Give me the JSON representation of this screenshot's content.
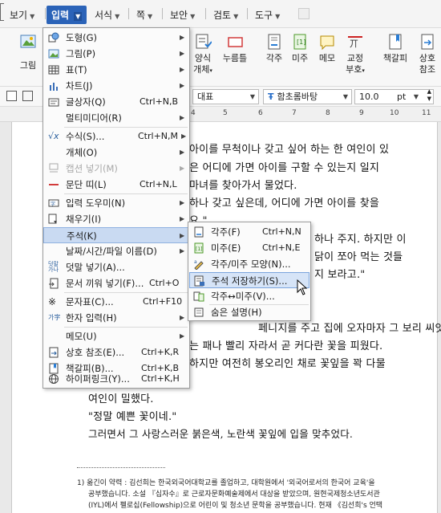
{
  "menubar": {
    "items": [
      {
        "label": "보기"
      },
      {
        "label": "입력"
      },
      {
        "label": "서식"
      },
      {
        "label": "쪽"
      },
      {
        "label": "보안"
      },
      {
        "label": "검토"
      },
      {
        "label": "도구"
      }
    ]
  },
  "toolbar": {
    "picture_label": "그림",
    "form_label_1": "양식",
    "form_label_2": "개체",
    "button_label": "누름틀",
    "footnote_label": "각주",
    "endnote_label": "미주",
    "memo_label": "메모",
    "proof_label_1": "교정",
    "proof_label_2": "부호",
    "bookmark_label": "책갈피",
    "crossref_label_1": "상호",
    "crossref_label_2": "참조"
  },
  "format": {
    "style": "대표",
    "font": "함초롬바탕",
    "font_icon": "Ŧ",
    "size": "10.0",
    "unit": "pt"
  },
  "ruler": {
    "numbers": [
      "4",
      "5",
      "6",
      "7",
      "8",
      "9",
      "10",
      "11"
    ]
  },
  "input_menu": {
    "items": [
      {
        "label": "도형(G)",
        "shortcut": "",
        "sub": true
      },
      {
        "label": "그림(P)",
        "shortcut": "",
        "sub": true
      },
      {
        "label": "표(T)",
        "shortcut": "",
        "sub": true
      },
      {
        "label": "차트(J)",
        "shortcut": "",
        "sub": true
      },
      {
        "label": "글상자(Q)",
        "shortcut": "Ctrl+N,B",
        "sub": false
      },
      {
        "label": "멀티미디어(R)",
        "shortcut": "",
        "sub": true
      },
      {
        "label": "수식(S)...",
        "shortcut": "Ctrl+N,M",
        "sub": true
      },
      {
        "label": "개체(O)",
        "shortcut": "",
        "sub": true
      },
      {
        "label": "캡션 넣기(M)",
        "shortcut": "",
        "sub": true
      },
      {
        "label": "문단 띠(L)",
        "shortcut": "Ctrl+N,L",
        "sub": false
      },
      {
        "label": "입력 도우미(N)",
        "shortcut": "",
        "sub": true
      },
      {
        "label": "채우기(I)",
        "shortcut": "",
        "sub": true
      },
      {
        "label": "주석(K)",
        "shortcut": "",
        "sub": true
      },
      {
        "label": "날짜/시간/파일 이름(D)",
        "shortcut": "",
        "sub": true
      },
      {
        "label": "덧말 넣기(A)...",
        "shortcut": "",
        "sub": false
      },
      {
        "label": "문서 끼워 넣기(F)...",
        "shortcut": "Ctrl+O",
        "sub": false
      },
      {
        "label": "문자표(C)...",
        "shortcut": "Ctrl+F10",
        "sub": false
      },
      {
        "label": "한자 입력(H)",
        "shortcut": "",
        "sub": true
      },
      {
        "label": "메모(U)",
        "shortcut": "",
        "sub": true
      },
      {
        "label": "상호 참조(E)...",
        "shortcut": "Ctrl+K,R",
        "sub": false
      },
      {
        "label": "책갈피(B)...",
        "shortcut": "Ctrl+K,B",
        "sub": false
      },
      {
        "label": "하이퍼링크(Y)...",
        "shortcut": "Ctrl+K,H",
        "sub": false
      }
    ]
  },
  "note_submenu": {
    "items": [
      {
        "label": "각주(F)",
        "shortcut": "Ctrl+N,N"
      },
      {
        "label": "미주(E)",
        "shortcut": "Ctrl+N,E"
      },
      {
        "label": "각주/미주 모양(N)...",
        "shortcut": ""
      },
      {
        "label": "주석 저장하기(S)...",
        "shortcut": ""
      },
      {
        "label": "각주↔미주(V)...",
        "shortcut": ""
      },
      {
        "label": "숨은 설명(H)",
        "shortcut": ""
      }
    ]
  },
  "document": {
    "lines": [
      "아이를 무척이나 갖고 싶어 하는 한 여인이 있",
      "은 어디에 가면 아이를 구할 수 있는지 일지",
      "마녀를 찾아가서 물었다.",
      "하나 갖고 싶은데, 어디에 가면 아이를 찾을",
      "요.\"",
      "하나 주지. 하지만 이",
      "닭이 쪼아 먹는 것들",
      "지 보라고.\"",
      "페니지를 주고 집에 오자마자 그 보리 씨앗을",
      "는 패나 빨리 자라서 곧 커다란 꽃을 피웠다.",
      "하지만 여전히 봉오리인 채로 꽃잎을 꽉 다물",
      "여인이 밀했다.",
      "\"정말 예쁜 꽃이네.\"",
      "그러면서 그 사랑스러운 붉은색, 노란색 꽃잎에 입을 맞추었다."
    ],
    "footnote": [
      "1) 옮긴이 약력 : 김선희는 한국외국어대학교를 졸업하고, 대학원에서 '외국어로서의 한국어 교육'을",
      "공부했습니다. 소설 『십자수』로 근로자문화예술제에서 대상을 받았으며, 원현국제청소년도서관",
      "(IYL)에서 펠로십(Fellowship)으로 어린이 및 청소년 문학을 공부했습니다. 현재 《김선희's 언택"
    ]
  }
}
